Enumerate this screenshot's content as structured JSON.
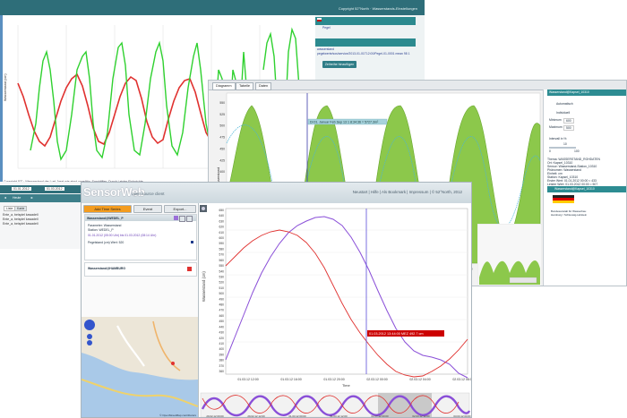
{
  "colors": {
    "teal": "#2e6e79",
    "red_series": "#e0312f",
    "green_series": "#2fd12f",
    "purple_series": "#8a4fd8",
    "fill_green": "#8cc84b"
  },
  "window_back": {
    "copyright": "Copyright 52°North · Wasserstands-Einstellungen",
    "footer": "Copyright 52° · Wasserstand der Lust Jasst wie einst ungefähr. Sanddiffen, Duroh Leister Eiskwichte",
    "add_button": "Zeitreihe hinzufügen",
    "series_links": [
      "Pegel",
      "wasserstand",
      "pegelwerte/sos/service/2013-01-01T12:00/Pegel-01-0001 mean 98 1"
    ],
    "dates": [
      "21.01.2012",
      "01.02.2012",
      "03.02.2012",
      "05.02.2012",
      "07.02.2012"
    ],
    "toolbar": {
      "time_from": "01.01.2012",
      "time_to": "01.03.2012",
      "buttons": [
        "◄",
        "Heute",
        "►"
      ]
    },
    "list_items": [
      "Ente_a, beispiel kawadell",
      "Ente_a, beispiel kawadell",
      "Ente_a, beispiel kawadell"
    ],
    "tabs": [
      "Liste",
      "Karte"
    ]
  },
  "window_mid": {
    "tabs": [
      "Diagramm",
      "Tabelle",
      "Daten"
    ],
    "tooltip": "Di 01. Januar Feb Sep 13 1 8:34:36 = 5727.3m²",
    "ylabel": "Wasserstand",
    "yticks": [
      "550",
      "525",
      "500",
      "475",
      "450",
      "425",
      "400",
      "375",
      "350",
      "325",
      "300",
      "275",
      "250",
      "225",
      "200"
    ],
    "xticks": [
      "03.02.12 00:00",
      "04.02.12",
      "05.02.12",
      "06.02.12",
      "07.02.12",
      "08.02.12"
    ],
    "right_panel": {
      "header": "Wasserstand@Kapsel_10310",
      "options": [
        "Automatisch",
        "Individuell"
      ],
      "min_label": "Minimum",
      "max_label": "Maximum",
      "min_val": "600",
      "max_val": "500",
      "interval_label": "Intervall in %",
      "interval_val": "10",
      "slider_a": "0",
      "slider_b": "100",
      "info": [
        "Thema: WASSERSTAND_ROHDATEN",
        "Ort: Kapsel_10310",
        "Sensor: Wasserstand-Station_10310",
        "Phänomen: Wasserstand",
        "Einheit: cm",
        "Station: Kapsel_10310",
        "Erster Wert: 01.01.2012 00:00 = 433",
        "Letzter Wert: 01.03.2012 00:00 = 507"
      ],
      "header2": "Wasserstand@Kapsel_10310",
      "logo_caption": "Bundesanstalt für Wasserbau",
      "logo_sub": "Hamburg / Schleswig-Holstein"
    }
  },
  "window_front": {
    "brand": "SensorWeb",
    "tagline": "open source client",
    "nav": "Neustart | Hilfe | Als Bookmark | Impressum | © 52°North, 2012",
    "add_button": "Add Time Series",
    "event_button": "Event",
    "export_button": "Export...",
    "series": [
      {
        "title": "Wasserstand@WEDEL_P",
        "lines": [
          "Parameter: Wasserstand",
          "Station: WEDEL_P"
        ],
        "range": "01.01.2012 (05:00 Uhr) bis 01.03.2012 (08:14 Uhr)",
        "latest": "Pegelstand (cm)    Wert: 520",
        "color": "#1e3a8a"
      },
      {
        "title": "Wasserstand@HAMBURG",
        "color": "#e0312f"
      }
    ],
    "chart": {
      "ylabel": "Wasserstand (cm)",
      "xlabel": "Time",
      "yticks": [
        "650",
        "640",
        "630",
        "620",
        "610",
        "600",
        "590",
        "580",
        "570",
        "560",
        "550",
        "540",
        "530",
        "520",
        "510",
        "500",
        "490",
        "480",
        "470",
        "460",
        "450",
        "440",
        "430",
        "420",
        "410",
        "400",
        "390",
        "380",
        "370",
        "360"
      ],
      "xticks": [
        "01.03.12 12:00",
        "01.03.12 16:00",
        "01.03.12 20:00",
        "02.03.12 00:00",
        "02.03.12 04:00",
        "02.03.12 08:00"
      ],
      "tooltip": "01.03.2012 13:44:00 MEZ  492.7 cm",
      "overview_ticks": [
        "29.02.12 00:00",
        "29.02.12 12:00",
        "01.03.12 00:00",
        "01.03.12 12:00",
        "02.03.12 00:00",
        "02.03.12 12:00",
        "03.03.12 00:00"
      ]
    },
    "map_attribution": "© OpenStreetMap contributors"
  }
}
